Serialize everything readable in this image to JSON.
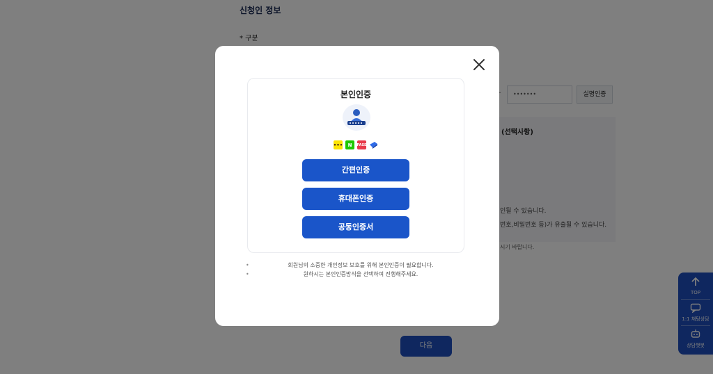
{
  "background": {
    "section_title": "신청인 정보",
    "field_label": "* 구분",
    "masked_value": "•••••••",
    "dash": "-",
    "verify_button": "실명인증",
    "optional_heading": "(선택사항)",
    "notice_line1": "인될 수 있습니다.",
    "notice_line2": "번호,비밀번호 등)가 유출될 수 있습니다.",
    "notice_line3": "시기 바랍니다.",
    "next_button": "다음"
  },
  "side_rail": {
    "top_label": "TOP",
    "chat_label": "1:1 채팅상담",
    "bot_label": "상담챗봇"
  },
  "modal": {
    "title": "본인인증",
    "providers": [
      {
        "name": "kakao",
        "glyph": "•••"
      },
      {
        "name": "naver",
        "glyph": "N"
      },
      {
        "name": "pass",
        "glyph": "PASS"
      },
      {
        "name": "toss",
        "glyph": ""
      }
    ],
    "buttons": {
      "simple": "간편인증",
      "phone": "휴대폰인증",
      "certificate": "공동인증서"
    },
    "notes": [
      "회원님의 소중한 개인정보 보호를 위해 본인인증이 필요합니다.",
      "원하시는 본인인증방식을 선택하여 진행해주세요."
    ]
  },
  "colors": {
    "primary": "#1a55c9",
    "overlay": "rgba(0,0,0,0.5)",
    "kakao": "#fee500",
    "naver": "#1ec800",
    "pass": "#e8394a"
  }
}
